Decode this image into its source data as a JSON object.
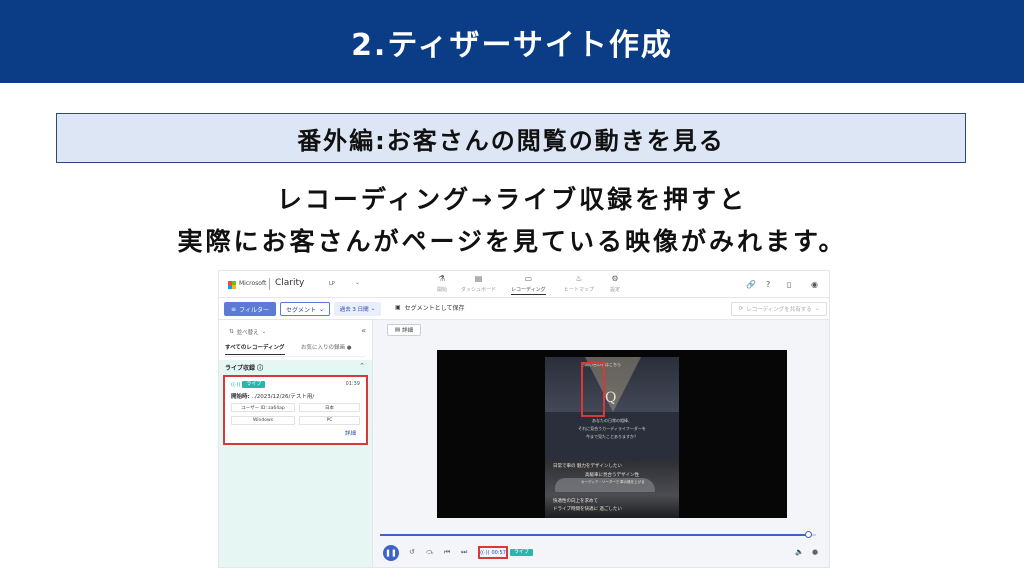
{
  "slide": {
    "title": "2.ティザーサイト作成",
    "subtitle": "番外編:お客さんの閲覧の動きを見る",
    "line1": "レコーディング→ライブ収録を押すと",
    "line2": "実際にお客さんがページを見ている映像がみれます。"
  },
  "colors": {
    "header_bg": "#0b3d86",
    "subtitle_bg": "#dce6f4",
    "highlight": "#d9383a",
    "accent": "#3d63c8",
    "live": "#29b6ad"
  },
  "app": {
    "brand": "Microsoft",
    "product": "Clarity",
    "project": "LP",
    "nav": [
      {
        "label": "開始",
        "icon": "flask-icon"
      },
      {
        "label": "ダッシュボード",
        "icon": "dashboard-icon"
      },
      {
        "label": "レコーディング",
        "icon": "video-icon",
        "active": true
      },
      {
        "label": "ヒートマップ",
        "icon": "flame-icon"
      },
      {
        "label": "設定",
        "icon": "gear-icon"
      }
    ],
    "filter_label": "フィルター",
    "segment_label": "セグメント",
    "period_label": "過去 3 日間",
    "save_segment_label": "セグメントとして保存",
    "share_label": "レコーディングを共有する",
    "sort_label": "並べ替え",
    "tab_all": "すべてのレコーディング",
    "tab_fav": "お気に入りの録画",
    "live_section_title": "ライブ収録",
    "card": {
      "live_label": "ライブ",
      "time": "01:39",
      "start_label": "開始時:",
      "start_value": "../2023/12/26/テスト用/",
      "user": "ユーザー ID: za64ap",
      "country": "日本",
      "os": "Windows",
      "device": "PC",
      "detail": "詳細"
    },
    "detail_button": "詳細",
    "player": {
      "banner": "お問い合わせはこちら",
      "letter": "Q",
      "text1": "あなたの日常の相棒、",
      "text2": "それに見合うカーディライフ―ダーを",
      "text3": "今まで見たことありますか？",
      "line1": "日常で車の 魅力をデザインしたい",
      "line2": "高級車に見合うデザイン性",
      "line3": "カーディア・ソーダーで 車の格を上げる",
      "line4": "快適性の向上を求めて",
      "line5": "ドライブ時間を快適に 過ごしたい"
    },
    "progress": 0.985,
    "time_display": "00:57",
    "live_pill": "ライブ"
  }
}
